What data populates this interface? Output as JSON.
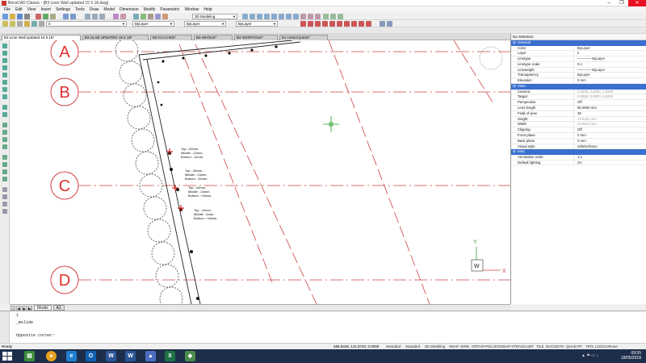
{
  "window": {
    "title": "BricsCAD Classic - [B3 Liner Wall updated 15 5 18.dwg]",
    "controls": [
      "–",
      "❐",
      "✕"
    ]
  },
  "menu": [
    "File",
    "Edit",
    "View",
    "Insert",
    "Settings",
    "Tools",
    "Draw",
    "Model",
    "Dimension",
    "Modify",
    "Parametric",
    "Window",
    "Help"
  ],
  "toolbar": {
    "workspace": "3D Modeling",
    "layer_value": "0",
    "color_value": "ByLayer",
    "linetype_value": "ByLayer",
    "lineweight_value": "ByLayer",
    "linetype2_value": "ByLayer"
  },
  "doc_tabs": [
    {
      "label": "B3 Liner Wall updated 15 5 18*",
      "active": true
    },
    {
      "label": "B3 SLAB UPDATED 15 5 18*",
      "active": false
    },
    {
      "label": "B3-C4-CHKD*",
      "active": false
    },
    {
      "label": "B4-WHOLE*",
      "active": false
    },
    {
      "label": "B4 W33PHOLE*",
      "active": false
    },
    {
      "label": "b4 control points*",
      "active": false
    }
  ],
  "grid_labels": [
    "A",
    "B",
    "C",
    "D"
  ],
  "annotations": [
    {
      "lines": [
        "Top: -40mm.",
        "Middle: -22mm.",
        "Bottom: -11mm."
      ]
    },
    {
      "lines": [
        "Top: -26mm.",
        "Middle: -24mm.",
        "Bottom: -32mm."
      ]
    },
    {
      "lines": [
        "Top: -28mm.",
        "Middle: -16mm.",
        "Bottom: +16mm."
      ]
    },
    {
      "lines": [
        "Top: -11mm.",
        "Middle: -6mm.",
        "Bottom: +18mm."
      ]
    }
  ],
  "ucs": {
    "y": "Y",
    "w": "W",
    "x": "X"
  },
  "layout_tabs": {
    "model": "Model",
    "layout": "A1"
  },
  "command": {
    "lines": [
      "1",
      "_mslide",
      "",
      "Opposite corner:"
    ]
  },
  "status": {
    "ready": "Ready",
    "coords": "486.5349, 141.8740, 0.0000",
    "items": [
      "Standard",
      "Standard",
      "3D Modeling",
      "SNAP",
      "GRID",
      "ORTHO",
      "POLAR",
      "ESNAP",
      "STRACK",
      "LWT",
      "TILE",
      "DUCS",
      "DYN",
      "QUAD",
      "RT",
      "TIPS",
      "LOCKUI",
      "None"
    ]
  },
  "properties": {
    "selection": "No Selection",
    "sections": [
      {
        "name": "General",
        "rows": [
          {
            "k": "Color",
            "v": "ByLayer"
          },
          {
            "k": "Layer",
            "v": "0"
          },
          {
            "k": "Linetype",
            "v": "———— ByLayer"
          },
          {
            "k": "Linetype scale",
            "v": "0.1"
          },
          {
            "k": "Lineweight",
            "v": "———— ByLayer"
          },
          {
            "k": "Transparency",
            "v": "ByLayer"
          },
          {
            "k": "Elevation",
            "v": "0 mm"
          }
        ]
      },
      {
        "name": "View",
        "rows": [
          {
            "k": "Camera",
            "v": "0.0000, 0.0000, 1.0000",
            "dim": true
          },
          {
            "k": "Target",
            "v": "0.0000, 0.0000, 0.0000",
            "dim": true
          },
          {
            "k": "Perspective",
            "v": "Off"
          },
          {
            "k": "Lens length",
            "v": "50.0000 mm"
          },
          {
            "k": "Field of view",
            "v": "39"
          },
          {
            "k": "Height",
            "v": "12.6161 mm",
            "dim": true
          },
          {
            "k": "Width",
            "v": "23.9521 mm",
            "dim": true
          },
          {
            "k": "Clipping",
            "v": "Off"
          },
          {
            "k": "Front plane",
            "v": "0 mm"
          },
          {
            "k": "Back plane",
            "v": "0 mm"
          },
          {
            "k": "Visual style",
            "v": "2dWireframe"
          }
        ]
      },
      {
        "name": "Misc",
        "rows": [
          {
            "k": "Annotation scale",
            "v": "1:1"
          },
          {
            "k": "Default lighting",
            "v": "On"
          }
        ]
      }
    ]
  },
  "taskbar": {
    "icons": [
      "ie-icon",
      "outlook-icon",
      "word-icon",
      "autocad-icon",
      "excel-icon",
      "chrome-icon"
    ],
    "time": "09:55",
    "date": "18/05/2018"
  }
}
